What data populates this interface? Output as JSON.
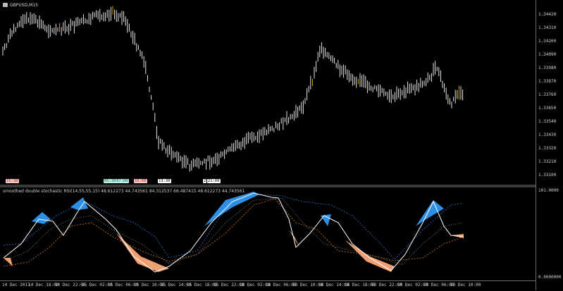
{
  "chart": {
    "symbol_title": "GBPUSD,M15",
    "price_ticks": [
      "1.34420",
      "1.34310",
      "1.34200",
      "1.34090",
      "1.33980",
      "1.33870",
      "1.33760",
      "1.33650",
      "1.33540",
      "1.33430",
      "1.33320",
      "1.33210",
      "1.33100"
    ],
    "time_ticks": [
      "14 Dec 2017",
      "14 Dec 18:00",
      "14 Dec 22:00",
      "15 Dec 02:00",
      "15 Dec 06:00",
      "15 Dec 10:00",
      "15 Dec 14:00",
      "15 Dec 18:00",
      "15 Dec 22:00",
      "18 Dec 02:00",
      "18 Dec 06:00",
      "18 Dec 10:00",
      "18 Dec 14:00",
      "18 Dec 18:00",
      "18 Dec 22:00",
      "19 Dec 02:00",
      "19 Dec 06:00",
      "19 Dec 10:00"
    ],
    "session_tags": [
      {
        "text": "15:30",
        "color": "#f2c9c9"
      },
      {
        "text": "05:30",
        "color": "#bff0e6"
      },
      {
        "text": "07:00",
        "color": "#bff0e6"
      },
      {
        "text": "10:00",
        "color": "#f2c9c9"
      },
      {
        "text": "13:30",
        "color": "#ffffff"
      },
      {
        "text": "2",
        "color": "#ffffff"
      },
      {
        "text": "21:00",
        "color": "#ffffff"
      }
    ]
  },
  "indicator": {
    "title": "smoothed double stochastic RSI(14,55,55,15) 48.612273 44.743561 84.312537 66.487415 48.612273 44.743561",
    "scale_top": "101.0000",
    "scale_bottom": "0.0000000"
  },
  "colors": {
    "up_fill": "#2e8fe6",
    "down_fill": "#f0a070",
    "main_line": "#ffffff",
    "dotted_blue": "#2f6fd6",
    "dotted_orange": "#d07a2a",
    "candle": "#e6e6e6"
  }
}
